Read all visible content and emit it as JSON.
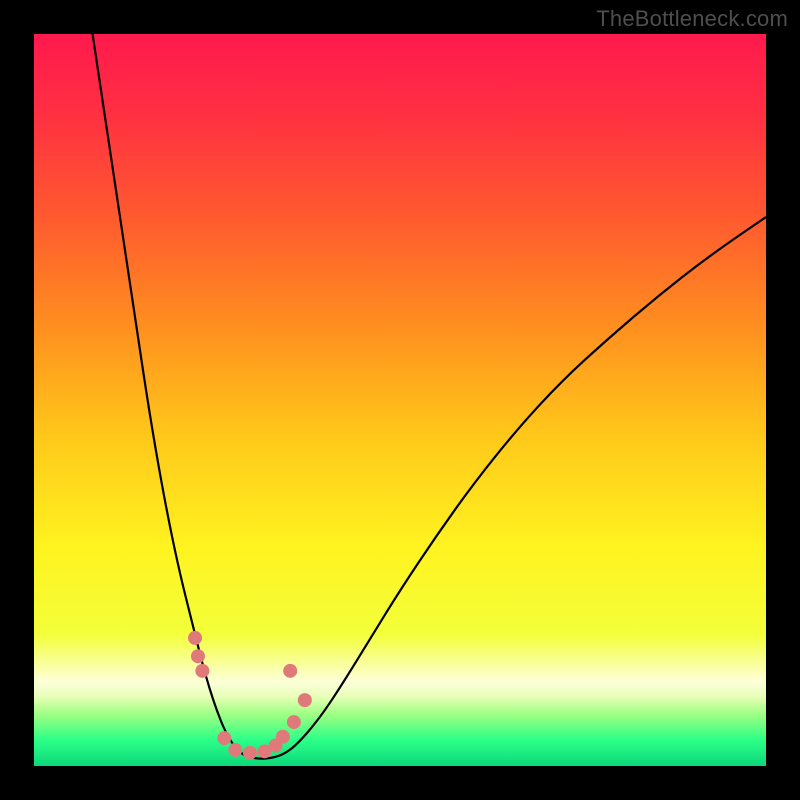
{
  "watermark": "TheBottleneck.com",
  "chart_data": {
    "type": "line",
    "title": "",
    "xlabel": "",
    "ylabel": "",
    "xlim": [
      0,
      100
    ],
    "ylim": [
      0,
      100
    ],
    "background_gradient": {
      "stops": [
        {
          "offset": 0.0,
          "color": "#ff1a4d"
        },
        {
          "offset": 0.1,
          "color": "#ff2d43"
        },
        {
          "offset": 0.25,
          "color": "#ff5a2f"
        },
        {
          "offset": 0.4,
          "color": "#ff8f1f"
        },
        {
          "offset": 0.55,
          "color": "#ffc81a"
        },
        {
          "offset": 0.7,
          "color": "#fff320"
        },
        {
          "offset": 0.82,
          "color": "#f3ff3a"
        },
        {
          "offset": 0.885,
          "color": "#fdffd8"
        },
        {
          "offset": 0.905,
          "color": "#e8ffb8"
        },
        {
          "offset": 0.93,
          "color": "#9cff82"
        },
        {
          "offset": 0.965,
          "color": "#2bff88"
        },
        {
          "offset": 1.0,
          "color": "#0bd879"
        }
      ]
    },
    "series": [
      {
        "name": "bottleneck-curve",
        "color": "#000000",
        "x": [
          8.0,
          9.5,
          11.0,
          12.5,
          14.0,
          15.5,
          17.0,
          18.5,
          20.0,
          21.5,
          23.0,
          24.0,
          25.0,
          26.0,
          27.0,
          28.0,
          29.0,
          30.5,
          32.0,
          34.0,
          36.0,
          39.0,
          42.0,
          46.0,
          50.0,
          55.0,
          60.0,
          66.0,
          72.0,
          78.0,
          85.0,
          92.0,
          100.0
        ],
        "y": [
          100.0,
          90.0,
          80.0,
          70.0,
          60.0,
          50.0,
          41.0,
          33.0,
          26.0,
          20.0,
          14.0,
          10.5,
          7.5,
          5.0,
          3.2,
          2.0,
          1.3,
          1.0,
          1.0,
          1.5,
          3.0,
          6.5,
          11.0,
          17.5,
          24.0,
          31.5,
          38.5,
          46.0,
          52.5,
          58.0,
          64.0,
          69.5,
          75.0
        ]
      }
    ],
    "markers": {
      "name": "data-points",
      "color": "#e07a7a",
      "radius_px": 7,
      "points": [
        {
          "x": 22.0,
          "y": 17.5
        },
        {
          "x": 22.4,
          "y": 15.0
        },
        {
          "x": 23.0,
          "y": 13.0
        },
        {
          "x": 26.0,
          "y": 3.8
        },
        {
          "x": 27.5,
          "y": 2.2
        },
        {
          "x": 29.5,
          "y": 1.8
        },
        {
          "x": 31.5,
          "y": 2.0
        },
        {
          "x": 33.0,
          "y": 2.8
        },
        {
          "x": 34.0,
          "y": 4.0
        },
        {
          "x": 35.5,
          "y": 6.0
        },
        {
          "x": 37.0,
          "y": 9.0
        },
        {
          "x": 35.0,
          "y": 13.0
        }
      ]
    }
  }
}
